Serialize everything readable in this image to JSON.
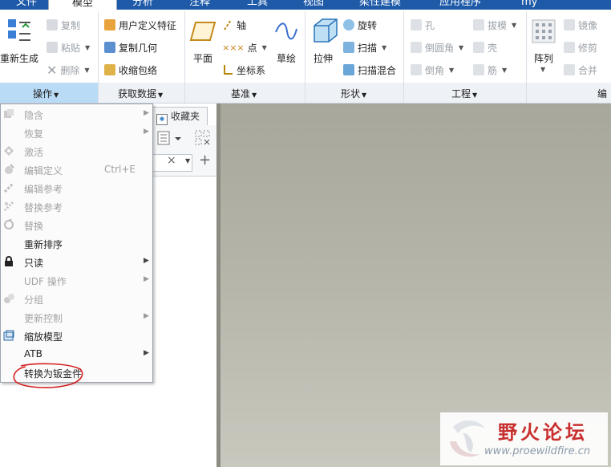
{
  "tabs": [
    {
      "label": "文件"
    },
    {
      "label": "模型"
    },
    {
      "label": "分析"
    },
    {
      "label": "注释"
    },
    {
      "label": "工具"
    },
    {
      "label": "视图"
    },
    {
      "label": "柔性建模"
    },
    {
      "label": "应用程序"
    },
    {
      "label": "my"
    }
  ],
  "ribbon": {
    "operations": {
      "regenerate": "重新生成",
      "copy": "复制",
      "paste": "粘贴",
      "delete": "删除",
      "group_label": "操作"
    },
    "get_data": {
      "udf": "用户定义特征",
      "copy_geom": "复制几何",
      "shrinkwrap": "收缩包络",
      "group_label": "获取数据"
    },
    "datum": {
      "plane": "平面",
      "axis": "轴",
      "point": "点",
      "csys": "坐标系",
      "sketch": "草绘",
      "group_label": "基准"
    },
    "shapes": {
      "extrude": "拉伸",
      "revolve": "旋转",
      "sweep": "扫描",
      "swept_blend": "扫描混合",
      "group_label": "形状"
    },
    "engineering": {
      "hole": "孔",
      "round": "倒圆角",
      "chamfer": "倒角",
      "draft": "拔模",
      "shell": "壳",
      "rib": "筋",
      "group_label": "工程"
    },
    "editing": {
      "pattern": "阵列",
      "mirror": "镜像",
      "trim": "修剪",
      "merge": "合并",
      "group_label": "编"
    }
  },
  "panel": {
    "favorites_tab": "收藏夹"
  },
  "context_menu": [
    {
      "label": "隐含",
      "enabled": false,
      "submenu": true,
      "shortcut": ""
    },
    {
      "label": "恢复",
      "enabled": false,
      "submenu": true,
      "shortcut": ""
    },
    {
      "label": "激活",
      "enabled": false,
      "submenu": false,
      "shortcut": ""
    },
    {
      "label": "编辑定义",
      "enabled": false,
      "submenu": false,
      "shortcut": "Ctrl+E"
    },
    {
      "label": "编辑参考",
      "enabled": false,
      "submenu": false,
      "shortcut": ""
    },
    {
      "label": "替换参考",
      "enabled": false,
      "submenu": false,
      "shortcut": ""
    },
    {
      "label": "替换",
      "enabled": false,
      "submenu": false,
      "shortcut": ""
    },
    {
      "label": "重新排序",
      "enabled": true,
      "submenu": false,
      "shortcut": ""
    },
    {
      "label": "只读",
      "enabled": true,
      "submenu": true,
      "shortcut": ""
    },
    {
      "label": "UDF 操作",
      "enabled": false,
      "submenu": true,
      "shortcut": ""
    },
    {
      "label": "分组",
      "enabled": false,
      "submenu": false,
      "shortcut": ""
    },
    {
      "label": "更新控制",
      "enabled": false,
      "submenu": true,
      "shortcut": ""
    },
    {
      "label": "缩放模型",
      "enabled": true,
      "submenu": false,
      "shortcut": ""
    },
    {
      "label": "ATB",
      "enabled": true,
      "submenu": true,
      "shortcut": ""
    },
    {
      "label": "转换为钣金件",
      "enabled": true,
      "submenu": false,
      "shortcut": ""
    }
  ],
  "watermark": {
    "title": "野火论坛",
    "url": "www.proewildfire.cn"
  },
  "colors": {
    "tabbar": "#1e5aa8",
    "active_group": "#b9dbf6",
    "highlight_circle": "#d42020"
  }
}
